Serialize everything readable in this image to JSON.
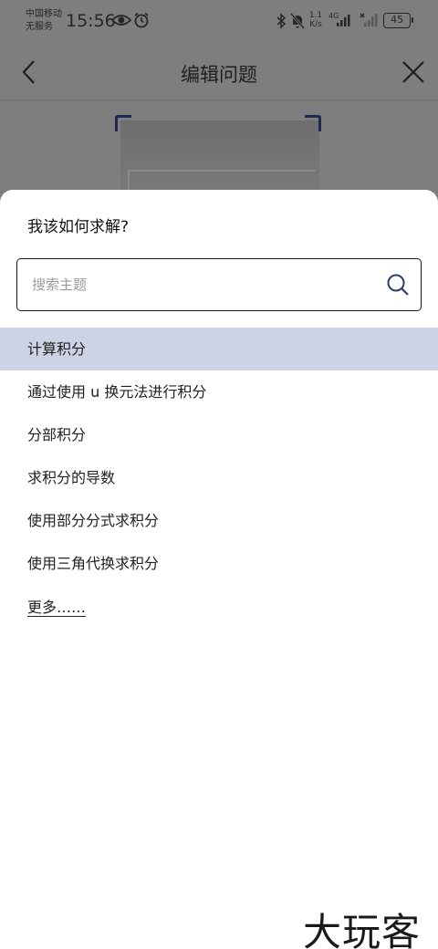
{
  "status_bar": {
    "carrier_line1": "中国移动",
    "carrier_line2": "无服务",
    "time": "15:56",
    "net_speed_value": "1.1",
    "net_speed_unit": "K/s",
    "signal_label": "4G",
    "battery": "45"
  },
  "header": {
    "title": "编辑问题"
  },
  "sheet": {
    "title": "我该如何求解?",
    "search": {
      "value": "",
      "placeholder": "搜索主题"
    },
    "topics": [
      {
        "label": "计算积分",
        "selected": true
      },
      {
        "label": "通过使用 u 换元法进行积分",
        "selected": false
      },
      {
        "label": "分部积分",
        "selected": false
      },
      {
        "label": "求积分的导数",
        "selected": false
      },
      {
        "label": "使用部分分式求积分",
        "selected": false
      },
      {
        "label": "使用三角代换求积分",
        "selected": false
      }
    ],
    "more_label": "更多……"
  },
  "watermark": "大玩客",
  "colors": {
    "selected_row": "#cbd3e4",
    "crop_corner": "#1b2a4e",
    "overlay": "#7e7e7e"
  },
  "icons": {
    "back": "chevron-left-icon",
    "close": "close-icon",
    "search": "search-icon"
  }
}
